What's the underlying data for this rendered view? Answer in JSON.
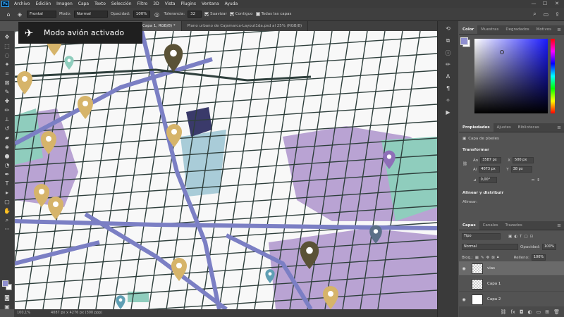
{
  "app": {
    "logo": "Ps"
  },
  "menubar": {
    "items": [
      "Archivo",
      "Edición",
      "Imagen",
      "Capa",
      "Texto",
      "Selección",
      "Filtro",
      "3D",
      "Vista",
      "Plugins",
      "Ventana",
      "Ayuda"
    ]
  },
  "window_controls": {
    "minimize": "—",
    "maximize": "☐",
    "close": "✕"
  },
  "options": {
    "fill_source": "Frontal",
    "mode_label": "Modo:",
    "mode_value": "Normal",
    "opacity_label": "Opacidad:",
    "opacity_value": "100%",
    "tolerance_label": "Tolerancia:",
    "tolerance_value": "32",
    "smooth_label": "Suavizar",
    "smooth_checked": true,
    "contiguous_label": "Contiguo",
    "contiguous_checked": true,
    "all_layers_label": "Todas las capas",
    "all_layers_checked": false
  },
  "doc_tabs": [
    {
      "label": "Capa 1, RGB/8) *",
      "active": true
    },
    {
      "label": "Plano urbano de Cajamarca-Layout1da.psd al 25% (RGB/8)",
      "active": false
    }
  ],
  "toast": {
    "icon": "airplane-icon",
    "text": "Modo avión activado"
  },
  "statusbar": {
    "zoom": "100,1%",
    "doc_size": "4087 px x 4276 px (300 ppp)"
  },
  "color_panel": {
    "tabs": [
      "Color",
      "Muestras",
      "Degradados",
      "Motivos"
    ],
    "foreground": "#8f8fd0",
    "background": "#ffffff"
  },
  "properties_panel": {
    "tabs": [
      "Propiedades",
      "Ajustes",
      "Bibliotecas"
    ],
    "layer_kind": "Capa de píxeles",
    "transform_title": "Transformar",
    "w_label": "An",
    "w_value": "3587 px",
    "x_label": "X",
    "x_value": "500 px",
    "h_label": "Al",
    "h_value": "4073 px",
    "y_label": "Y",
    "y_value": "38 px",
    "angle_value": "0,00°",
    "align_title": "Alinear y distribuir",
    "align_label": "Alinear:"
  },
  "layers_panel": {
    "tabs": [
      "Capas",
      "Canales",
      "Trazados"
    ],
    "filter_label": "Tipo",
    "blend_mode": "Normal",
    "opacity_label": "Opacidad:",
    "opacity_value": "100%",
    "lock_label": "Bloq.:",
    "fill_label": "Relleno:",
    "fill_value": "100%",
    "layers": [
      {
        "name": "vias",
        "selected": true
      },
      {
        "name": "Capa 1",
        "selected": false
      },
      {
        "name": "Capa 2",
        "selected": false
      }
    ]
  },
  "map": {
    "colors": {
      "background": "#f8f8f8",
      "streets": "#2e3f3c",
      "main_avenues": "#7b7fc4",
      "lavender_blocks": "#b9a3d3",
      "teal_blocks": "#8fcdbd",
      "light_blue_blocks": "#a9ccd8",
      "gold_pins": "#d6b46a",
      "dark_pins": "#5a5236",
      "navy_block": "#3a3a6a"
    },
    "pin_icons": [
      "gold-location-pin",
      "dark-location-pin",
      "teal-location-pin",
      "purple-location-pin",
      "slate-location-pin"
    ]
  }
}
